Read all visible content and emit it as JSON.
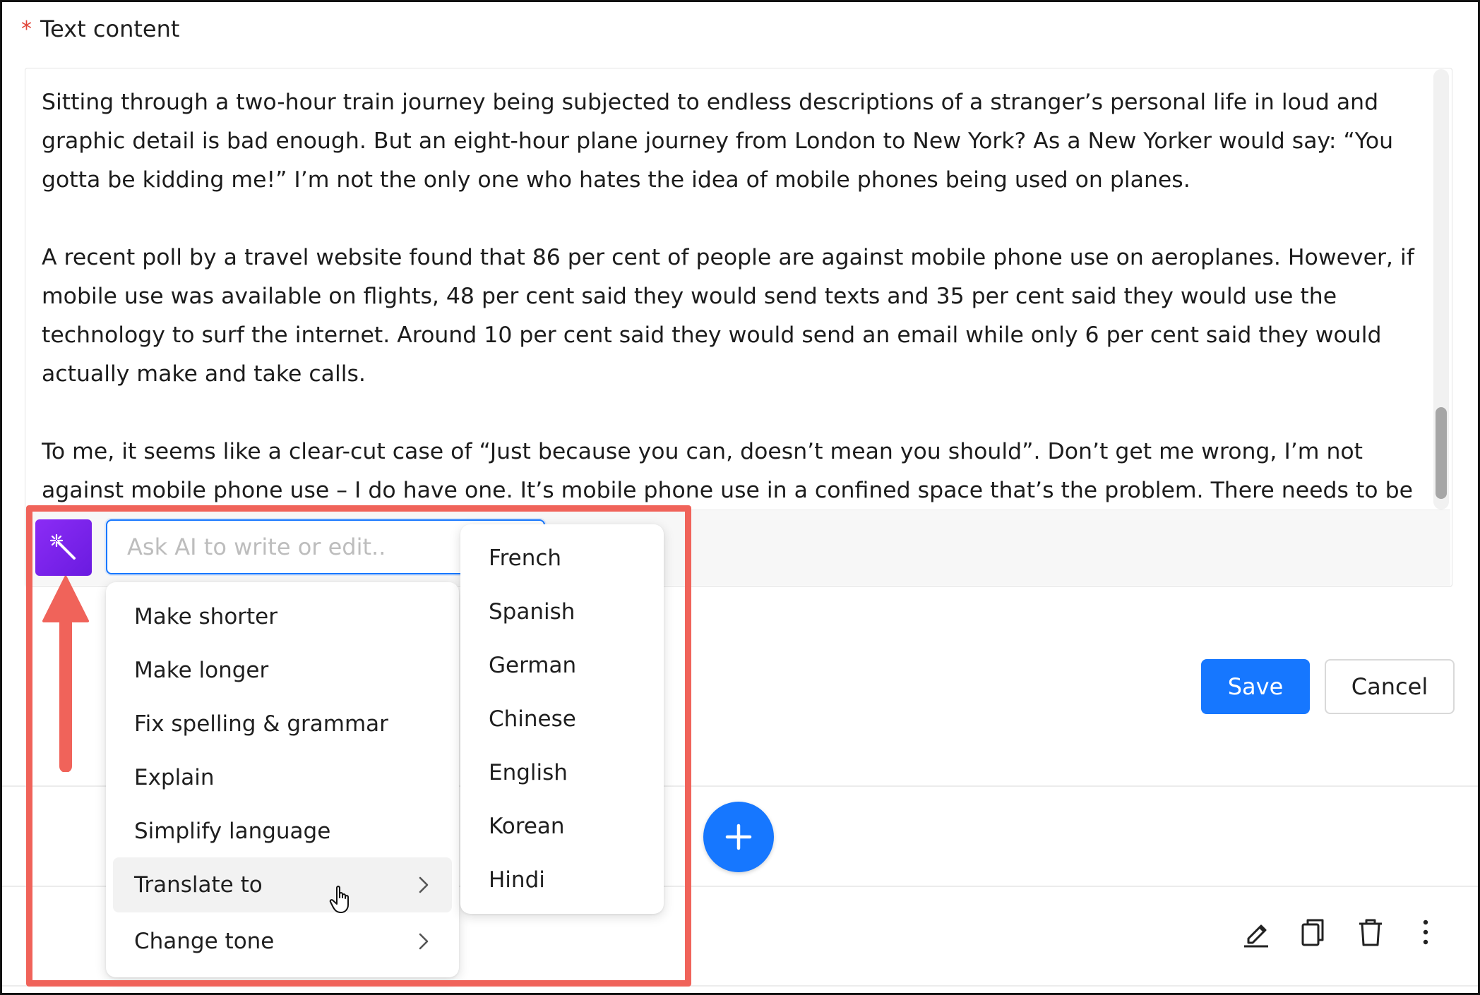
{
  "field": {
    "required_mark": "*",
    "label": "Text content"
  },
  "editor": {
    "paragraphs": [
      "Sitting through a two-hour train journey being subjected to endless descriptions of a stranger’s personal life in loud and graphic detail is bad enough. But an eight-hour plane journey from London to New York? As a New Yorker would say: “You gotta be kidding me!” I’m not the only one who hates the idea of mobile phones being used on planes.",
      "A recent poll by a travel website found that 86 per cent of people are against mobile phone use on aeroplanes. However, if mobile use was available on flights, 48 per cent said they would send texts and 35 per cent said they would use the technology to surf the internet. Around 10 per cent said they would send an email while only 6 per cent said they would actually make and take calls.",
      "To me, it seems like a clear-cut case of “Just because you can, doesn’t mean you should”. Don’t get me wrong, I’m not against mobile phone use – I do have one. It’s mobile phone use in a confined space that’s the problem. There needs to be"
    ]
  },
  "ai": {
    "wand_icon": "magic-wand-icon",
    "input_placeholder": "Ask AI to write or edit..",
    "input_value": "",
    "menu_items": [
      {
        "label": "Make shorter"
      },
      {
        "label": "Make longer"
      },
      {
        "label": "Fix spelling & grammar"
      },
      {
        "label": "Explain"
      },
      {
        "label": "Simplify language"
      },
      {
        "label": "Translate to",
        "has_submenu": true,
        "hovered": true
      },
      {
        "label": "Change tone",
        "has_submenu": true
      }
    ],
    "translate_languages": [
      "French",
      "Spanish",
      "German",
      "Chinese",
      "English",
      "Korean",
      "Hindi"
    ]
  },
  "actions": {
    "save_label": "Save",
    "cancel_label": "Cancel"
  },
  "toolbar_icons": [
    "edit-icon",
    "copy-icon",
    "delete-icon",
    "more-vertical-icon"
  ],
  "colors": {
    "primary": "#1677ff",
    "ai_purple": "#7b22ea",
    "annotation_red": "#f0635a",
    "required_red": "#e0463a"
  }
}
